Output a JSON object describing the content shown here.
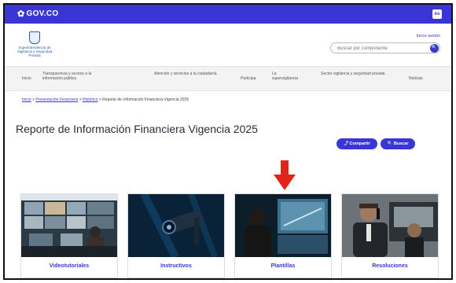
{
  "gov_bar": {
    "logo_text": "GOV.CO",
    "lang_badge": "es"
  },
  "entity": {
    "name": "Superintendencia de Vigilancia y Seguridad Privada"
  },
  "header": {
    "login": "Inicio sesión",
    "search_placeholder": "Buscar por componente"
  },
  "nav": [
    "Inicio",
    "Transparencia y acceso a la información pública",
    "Atención y servicios a la ciudadanía",
    "Participa",
    "La supervigilancia",
    "Sector vigilancia y seguridad privada",
    "Noticias"
  ],
  "breadcrumb": {
    "items": [
      "Inicio",
      "Presentación Financiera",
      "Histórico",
      "Reporte de Información Financiera Vigencia 2025"
    ],
    "separator": ">"
  },
  "page": {
    "title": "Reporte de Información Financiera Vigencia 2025"
  },
  "actions": {
    "share": "Compartir",
    "search": "Buscar"
  },
  "cards": [
    {
      "label": "Videotutoriales"
    },
    {
      "label": "Instructivos"
    },
    {
      "label": "Plantillas"
    },
    {
      "label": "Resoluciones"
    }
  ],
  "colors": {
    "primary": "#3a36d6",
    "arrow": "#e02417",
    "title": "#2c2c3a"
  }
}
